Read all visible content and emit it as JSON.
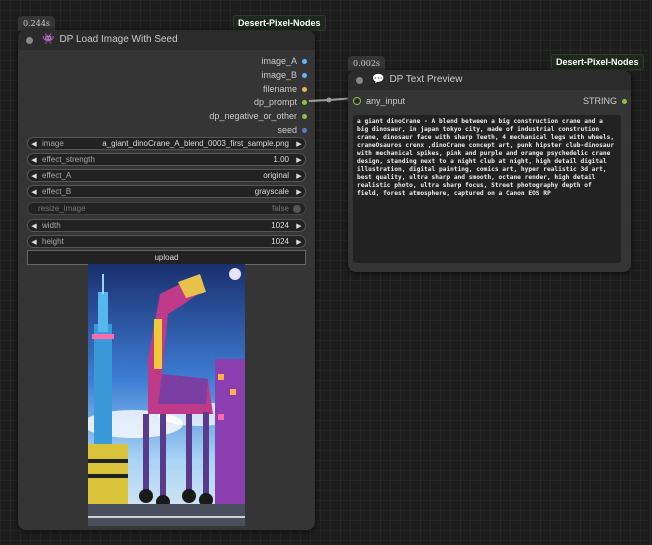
{
  "load_node": {
    "timing": "0.244s",
    "badge": "Desert-Pixel-Nodes",
    "icon": "ghost-emoji-icon",
    "title": "DP Load Image With Seed",
    "outputs": [
      {
        "label": "image_A",
        "color": "#64b5f6"
      },
      {
        "label": "image_B",
        "color": "#64b5f6"
      },
      {
        "label": "filename",
        "color": "#e5b25e"
      },
      {
        "label": "dp_prompt",
        "color": "#8bc34a"
      },
      {
        "label": "dp_negative_or_other",
        "color": "#8bc34a"
      },
      {
        "label": "seed",
        "color": "#5a7dc7"
      }
    ],
    "widgets": {
      "image": {
        "label": "image",
        "value": "a_giant_dinoCrane_A_blend_0003_first_sample.png"
      },
      "effect_strength": {
        "label": "effect_strength",
        "value": "1.00"
      },
      "effect_A": {
        "label": "effect_A",
        "value": "original"
      },
      "effect_B": {
        "label": "effect_B",
        "value": "grayscale"
      },
      "resize_image": {
        "label": "resize_image",
        "value": "false"
      },
      "width": {
        "label": "width",
        "value": "1024"
      },
      "height": {
        "label": "height",
        "value": "1024"
      }
    },
    "upload_label": "upload"
  },
  "text_node": {
    "timing": "0.002s",
    "badge": "Desert-Pixel-Nodes",
    "icon": "speech-bubble-emoji-icon",
    "title": "DP Text Preview",
    "input_label": "any_input",
    "output_label": "STRING",
    "text": "a giant dinoCrane - A blend between a big construction crane and a big dinosaur, in japan tokyo city, made of industrial constrution crane, dinosaur face with sharp Teeth, 4 mechanical legs with wheels, craneOsauros crenx ,dinoCrane concept art, punk hipster club-dinosaur with mechanical spikes, pink and purple and orange psychedelic crane design, standing next to a night club at night, high detail digital illustration, digital painting, comics art, hyper realistic 3d art, best quality, ultra sharp and smooth, octane render, high detail realistic photo, ultra sharp focus, Street photography depth of field, forest atmosphere, captured on a Canon EOS RP"
  },
  "colors": {
    "canvas": "#1d1d1d",
    "node_body": "#353535",
    "node_title": "#2b2b2b",
    "link": "#9e9e9e",
    "string_slot": "#8bc34a"
  }
}
